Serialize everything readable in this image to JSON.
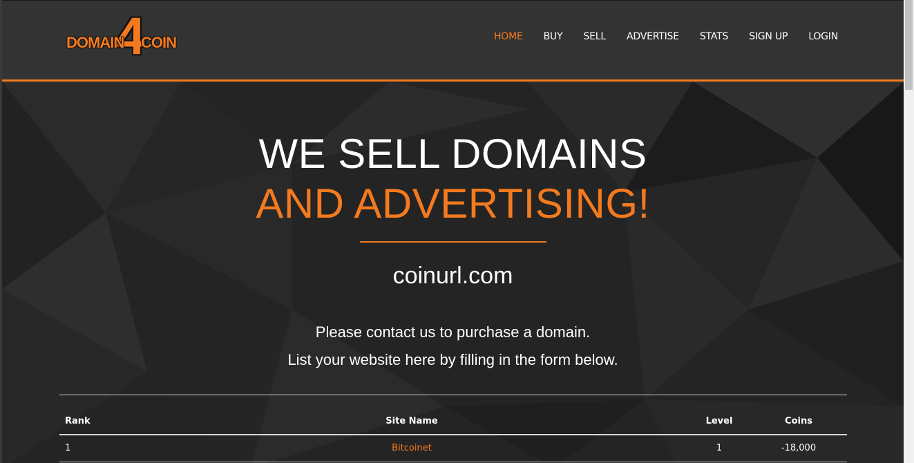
{
  "logo": {
    "left_text": "DOMAIN",
    "digit": "4",
    "right_text": "COIN"
  },
  "nav": [
    {
      "label": "HOME",
      "active": true
    },
    {
      "label": "BUY"
    },
    {
      "label": "SELL"
    },
    {
      "label": "ADVERTISE"
    },
    {
      "label": "STATS"
    },
    {
      "label": "SIGN UP"
    },
    {
      "label": "LOGIN"
    }
  ],
  "hero": {
    "headline_white": "WE SELL DOMAINS",
    "headline_orange": "AND ADVERTISING!",
    "domain": "coinurl.com",
    "contact_line1": "Please contact us to purchase a domain.",
    "contact_line2": "List your website here by filling in the form below."
  },
  "table": {
    "headers": {
      "rank": "Rank",
      "site": "Site Name",
      "level": "Level",
      "coins": "Coins"
    },
    "rows": [
      {
        "rank": "1",
        "site": "Bitcoinet",
        "level": "1",
        "coins": "-18,000"
      }
    ]
  },
  "colors": {
    "accent": "#f47a1f",
    "header_bg": "#333333",
    "hero_bg": "#242424"
  }
}
